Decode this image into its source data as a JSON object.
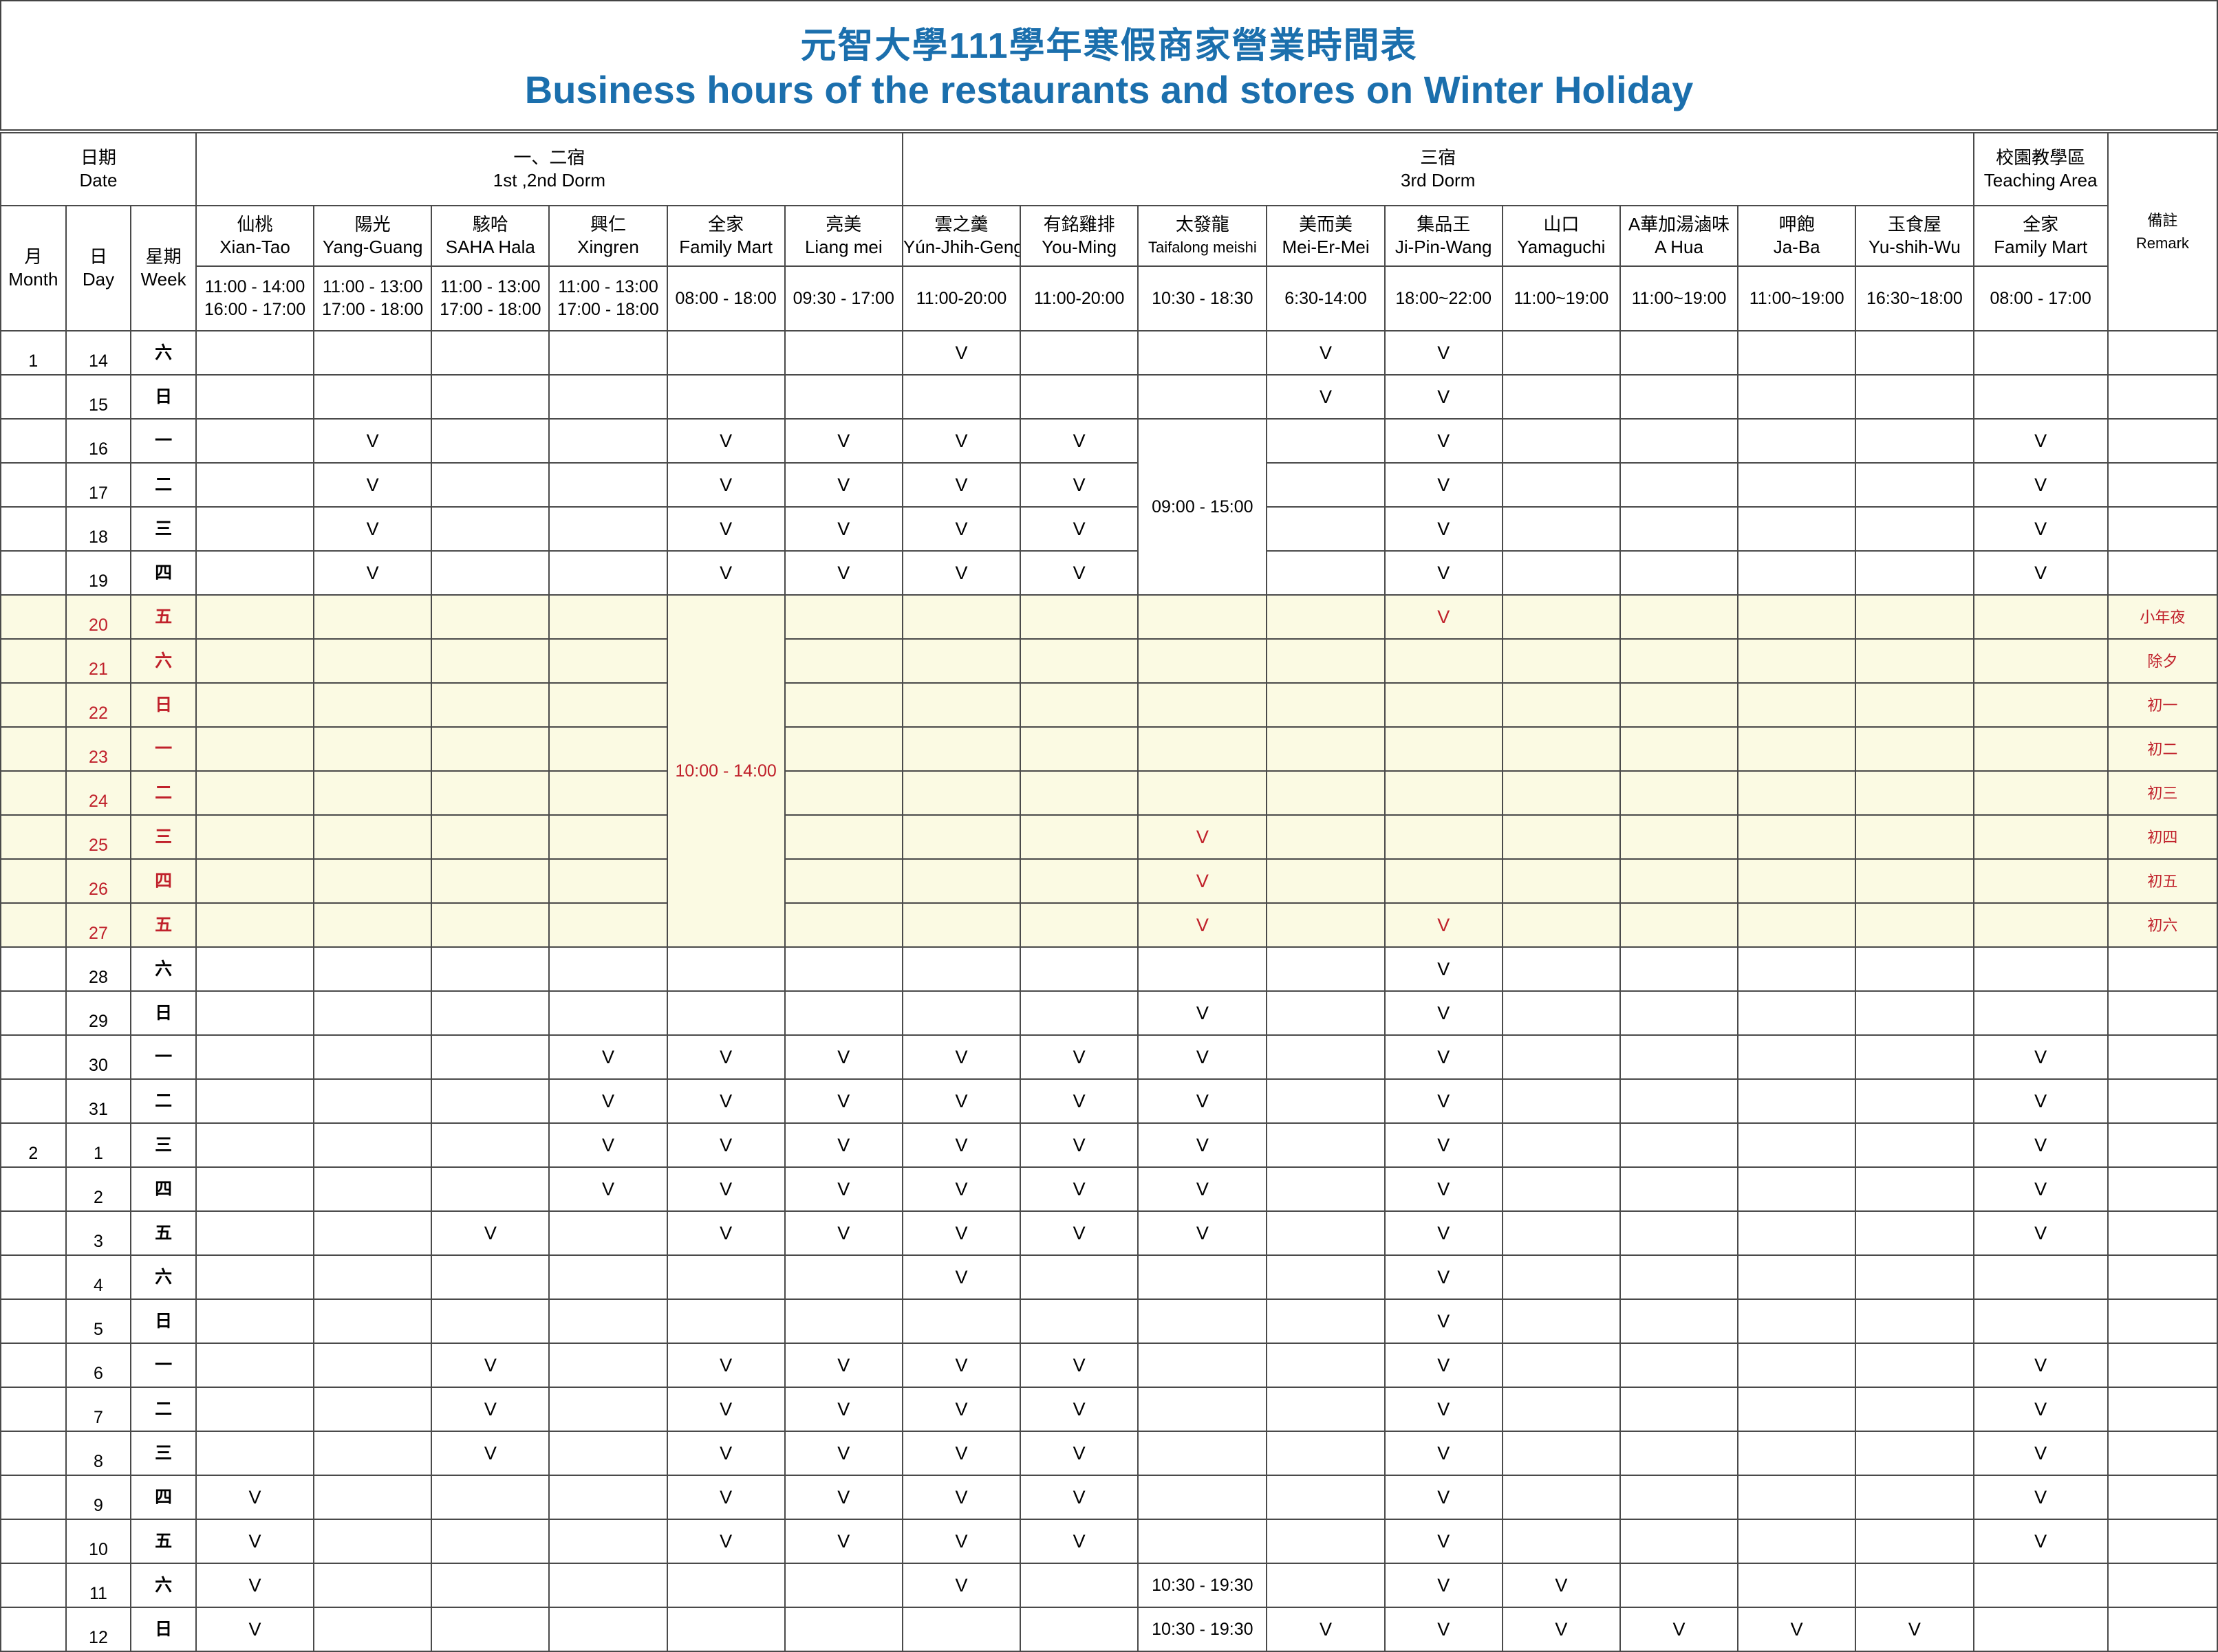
{
  "title": {
    "zh": "元智大學111學年寒假商家營業時間表",
    "en": "Business hours of the restaurants and stores on Winter Holiday"
  },
  "groups": {
    "date": [
      "日期",
      "Date"
    ],
    "dorm12": [
      "一、二宿",
      "1st ,2nd Dorm"
    ],
    "dorm3": [
      "三宿",
      "3rd Dorm"
    ],
    "teaching": [
      "校園教學區",
      "Teaching Area"
    ],
    "remark": [
      "備註",
      "Remark"
    ]
  },
  "dateCols": [
    [
      "月",
      "Month"
    ],
    [
      "日",
      "Day"
    ],
    [
      "星期",
      "Week"
    ]
  ],
  "stores": [
    {
      "zh": "仙桃",
      "en": "Xian-Tao",
      "hours": [
        "11:00 - 14:00",
        "16:00 - 17:00"
      ]
    },
    {
      "zh": "陽光",
      "en": "Yang-Guang",
      "hours": [
        "11:00 - 13:00",
        "17:00 - 18:00"
      ]
    },
    {
      "zh": "駭哈",
      "en": "SAHA Hala",
      "hours": [
        "11:00 - 13:00",
        "17:00 - 18:00"
      ]
    },
    {
      "zh": "興仁",
      "en": "Xingren",
      "hours": [
        "11:00 - 13:00",
        "17:00 - 18:00"
      ]
    },
    {
      "zh": "全家",
      "en": "Family Mart",
      "hours": [
        "08:00 - 18:00"
      ]
    },
    {
      "zh": "亮美",
      "en": "Liang mei",
      "hours": [
        "09:30 - 17:00"
      ]
    },
    {
      "zh": "雲之羹",
      "en": "Yún-Jhih-Geng",
      "hours": [
        "11:00-20:00"
      ]
    },
    {
      "zh": "有銘雞排",
      "en": "You-Ming",
      "hours": [
        "11:00-20:00"
      ]
    },
    {
      "zh": "太發龍",
      "en": "Taifalong meishi",
      "hours": [
        "10:30 - 18:30"
      ]
    },
    {
      "zh": "美而美",
      "en": "Mei-Er-Mei",
      "hours": [
        "6:30-14:00"
      ]
    },
    {
      "zh": "集品王",
      "en": "Ji-Pin-Wang",
      "hours": [
        "18:00~22:00"
      ]
    },
    {
      "zh": "山口",
      "en": "Yamaguchi",
      "hours": [
        "11:00~19:00"
      ]
    },
    {
      "zh": "A華加湯滷味",
      "en": "A Hua",
      "hours": [
        "11:00~19:00"
      ]
    },
    {
      "zh": "呷飽",
      "en": "Ja-Ba",
      "hours": [
        "11:00~19:00"
      ]
    },
    {
      "zh": "玉食屋",
      "en": "Yu-shih-Wu",
      "hours": [
        "16:30~18:00"
      ]
    },
    {
      "zh": "全家",
      "en": "Family Mart",
      "hours": [
        "08:00 - 17:00"
      ]
    }
  ],
  "spanTexts": {
    "taifalong_mid": "09:00 - 15:00",
    "family_holiday": "10:00 - 14:00",
    "taifalong_11": "10:30 - 19:30",
    "taifalong_12": "10:30 - 19:30"
  },
  "rows": [
    {
      "m": "1",
      "d": "14",
      "w": "六",
      "cells": [
        "",
        "",
        "",
        "",
        "",
        "",
        "V",
        "",
        "",
        "V",
        "V",
        "",
        "",
        "",
        "",
        ""
      ],
      "remark": ""
    },
    {
      "m": "",
      "d": "15",
      "w": "日",
      "cells": [
        "",
        "",
        "",
        "",
        "",
        "",
        "",
        "",
        "",
        "V",
        "V",
        "",
        "",
        "",
        "",
        ""
      ],
      "remark": ""
    },
    {
      "m": "",
      "d": "16",
      "w": "一",
      "cells": [
        "",
        "V",
        "",
        "",
        "V",
        "V",
        "V",
        "V",
        "",
        "",
        "V",
        "",
        "",
        "",
        "",
        "V"
      ],
      "remark": ""
    },
    {
      "m": "",
      "d": "17",
      "w": "二",
      "cells": [
        "",
        "V",
        "",
        "",
        "V",
        "V",
        "V",
        "V",
        "",
        "",
        "V",
        "",
        "",
        "",
        "",
        "V"
      ],
      "remark": ""
    },
    {
      "m": "",
      "d": "18",
      "w": "三",
      "cells": [
        "",
        "V",
        "",
        "",
        "V",
        "V",
        "V",
        "V",
        "",
        "",
        "V",
        "",
        "",
        "",
        "",
        "V"
      ],
      "remark": ""
    },
    {
      "m": "",
      "d": "19",
      "w": "四",
      "cells": [
        "",
        "V",
        "",
        "",
        "V",
        "V",
        "V",
        "V",
        "",
        "",
        "V",
        "",
        "",
        "",
        "",
        "V"
      ],
      "remark": ""
    },
    {
      "m": "",
      "d": "20",
      "w": "五",
      "cells": [
        "",
        "",
        "",
        "",
        "",
        "",
        "",
        "",
        "",
        "",
        "V",
        "",
        "",
        "",
        "",
        ""
      ],
      "remark": "小年夜"
    },
    {
      "m": "",
      "d": "21",
      "w": "六",
      "cells": [
        "",
        "",
        "",
        "",
        "",
        "",
        "",
        "",
        "",
        "",
        "",
        "",
        "",
        "",
        "",
        ""
      ],
      "remark": "除夕"
    },
    {
      "m": "",
      "d": "22",
      "w": "日",
      "cells": [
        "",
        "",
        "",
        "",
        "",
        "",
        "",
        "",
        "",
        "",
        "",
        "",
        "",
        "",
        "",
        ""
      ],
      "remark": "初一"
    },
    {
      "m": "",
      "d": "23",
      "w": "一",
      "cells": [
        "",
        "",
        "",
        "",
        "",
        "",
        "",
        "",
        "",
        "",
        "",
        "",
        "",
        "",
        "",
        ""
      ],
      "remark": "初二"
    },
    {
      "m": "",
      "d": "24",
      "w": "二",
      "cells": [
        "",
        "",
        "",
        "",
        "",
        "",
        "",
        "",
        "",
        "",
        "",
        "",
        "",
        "",
        "",
        ""
      ],
      "remark": "初三"
    },
    {
      "m": "",
      "d": "25",
      "w": "三",
      "cells": [
        "",
        "",
        "",
        "",
        "",
        "",
        "",
        "",
        "V",
        "",
        "",
        "",
        "",
        "",
        "",
        ""
      ],
      "remark": "初四"
    },
    {
      "m": "",
      "d": "26",
      "w": "四",
      "cells": [
        "",
        "",
        "",
        "",
        "",
        "",
        "",
        "",
        "V",
        "",
        "",
        "",
        "",
        "",
        "",
        ""
      ],
      "remark": "初五"
    },
    {
      "m": "",
      "d": "27",
      "w": "五",
      "cells": [
        "",
        "",
        "",
        "",
        "",
        "",
        "",
        "",
        "V",
        "",
        "V",
        "",
        "",
        "",
        "",
        ""
      ],
      "remark": "初六"
    },
    {
      "m": "",
      "d": "28",
      "w": "六",
      "cells": [
        "",
        "",
        "",
        "",
        "",
        "",
        "",
        "",
        "",
        "",
        "V",
        "",
        "",
        "",
        "",
        ""
      ],
      "remark": ""
    },
    {
      "m": "",
      "d": "29",
      "w": "日",
      "cells": [
        "",
        "",
        "",
        "",
        "",
        "",
        "",
        "",
        "V",
        "",
        "V",
        "",
        "",
        "",
        "",
        ""
      ],
      "remark": ""
    },
    {
      "m": "",
      "d": "30",
      "w": "一",
      "cells": [
        "",
        "",
        "",
        "V",
        "V",
        "V",
        "V",
        "V",
        "V",
        "",
        "V",
        "",
        "",
        "",
        "",
        "V"
      ],
      "remark": ""
    },
    {
      "m": "",
      "d": "31",
      "w": "二",
      "cells": [
        "",
        "",
        "",
        "V",
        "V",
        "V",
        "V",
        "V",
        "V",
        "",
        "V",
        "",
        "",
        "",
        "",
        "V"
      ],
      "remark": ""
    },
    {
      "m": "2",
      "d": "1",
      "w": "三",
      "cells": [
        "",
        "",
        "",
        "V",
        "V",
        "V",
        "V",
        "V",
        "V",
        "",
        "V",
        "",
        "",
        "",
        "",
        "V"
      ],
      "remark": ""
    },
    {
      "m": "",
      "d": "2",
      "w": "四",
      "cells": [
        "",
        "",
        "",
        "V",
        "V",
        "V",
        "V",
        "V",
        "V",
        "",
        "V",
        "",
        "",
        "",
        "",
        "V"
      ],
      "remark": ""
    },
    {
      "m": "",
      "d": "3",
      "w": "五",
      "cells": [
        "",
        "",
        "V",
        "",
        "V",
        "V",
        "V",
        "V",
        "V",
        "",
        "V",
        "",
        "",
        "",
        "",
        "V"
      ],
      "remark": ""
    },
    {
      "m": "",
      "d": "4",
      "w": "六",
      "cells": [
        "",
        "",
        "",
        "",
        "",
        "",
        "V",
        "",
        "",
        "",
        "V",
        "",
        "",
        "",
        "",
        ""
      ],
      "remark": ""
    },
    {
      "m": "",
      "d": "5",
      "w": "日",
      "cells": [
        "",
        "",
        "",
        "",
        "",
        "",
        "",
        "",
        "",
        "",
        "V",
        "",
        "",
        "",
        "",
        ""
      ],
      "remark": ""
    },
    {
      "m": "",
      "d": "6",
      "w": "一",
      "cells": [
        "",
        "",
        "V",
        "",
        "V",
        "V",
        "V",
        "V",
        "",
        "",
        "V",
        "",
        "",
        "",
        "",
        "V"
      ],
      "remark": ""
    },
    {
      "m": "",
      "d": "7",
      "w": "二",
      "cells": [
        "",
        "",
        "V",
        "",
        "V",
        "V",
        "V",
        "V",
        "",
        "",
        "V",
        "",
        "",
        "",
        "",
        "V"
      ],
      "remark": ""
    },
    {
      "m": "",
      "d": "8",
      "w": "三",
      "cells": [
        "",
        "",
        "V",
        "",
        "V",
        "V",
        "V",
        "V",
        "",
        "",
        "V",
        "",
        "",
        "",
        "",
        "V"
      ],
      "remark": ""
    },
    {
      "m": "",
      "d": "9",
      "w": "四",
      "cells": [
        "V",
        "",
        "",
        "",
        "V",
        "V",
        "V",
        "V",
        "",
        "",
        "V",
        "",
        "",
        "",
        "",
        "V"
      ],
      "remark": ""
    },
    {
      "m": "",
      "d": "10",
      "w": "五",
      "cells": [
        "V",
        "",
        "",
        "",
        "V",
        "V",
        "V",
        "V",
        "",
        "",
        "V",
        "",
        "",
        "",
        "",
        "V"
      ],
      "remark": ""
    },
    {
      "m": "",
      "d": "11",
      "w": "六",
      "cells": [
        "V",
        "",
        "",
        "",
        "",
        "",
        "V",
        "",
        "",
        "",
        "V",
        "V",
        "",
        "",
        "",
        ""
      ],
      "remark": ""
    },
    {
      "m": "",
      "d": "12",
      "w": "日",
      "cells": [
        "V",
        "",
        "",
        "",
        "",
        "",
        "",
        "",
        "",
        "V",
        "V",
        "V",
        "V",
        "V",
        "V",
        ""
      ],
      "remark": ""
    }
  ]
}
